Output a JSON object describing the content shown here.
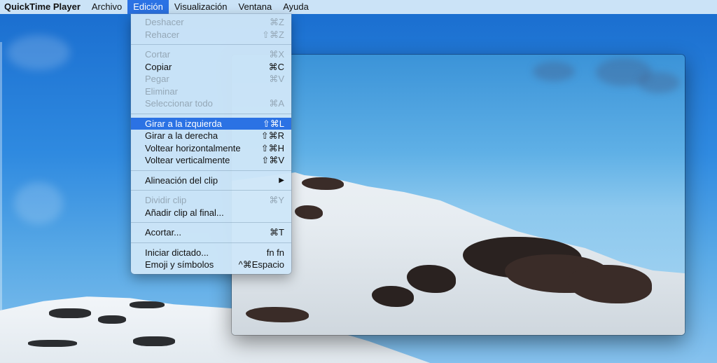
{
  "menubar": {
    "app": "QuickTime Player",
    "items": [
      "Archivo",
      "Edición",
      "Visualización",
      "Ventana",
      "Ayuda"
    ],
    "active_item": "Edición"
  },
  "menu": {
    "groups": [
      [
        {
          "label": "Deshacer",
          "shortcut": "⌘Z",
          "enabled": false
        },
        {
          "label": "Rehacer",
          "shortcut": "⇧⌘Z",
          "enabled": false
        }
      ],
      [
        {
          "label": "Cortar",
          "shortcut": "⌘X",
          "enabled": false
        },
        {
          "label": "Copiar",
          "shortcut": "⌘C",
          "enabled": true
        },
        {
          "label": "Pegar",
          "shortcut": "⌘V",
          "enabled": false
        },
        {
          "label": "Eliminar",
          "shortcut": "",
          "enabled": false
        },
        {
          "label": "Seleccionar todo",
          "shortcut": "⌘A",
          "enabled": false
        }
      ],
      [
        {
          "label": "Girar a la izquierda",
          "shortcut": "⇧⌘L",
          "enabled": true,
          "highlighted": true
        },
        {
          "label": "Girar a la derecha",
          "shortcut": "⇧⌘R",
          "enabled": true
        },
        {
          "label": "Voltear horizontalmente",
          "shortcut": "⇧⌘H",
          "enabled": true
        },
        {
          "label": "Voltear verticalmente",
          "shortcut": "⇧⌘V",
          "enabled": true
        }
      ],
      [
        {
          "label": "Alineación del clip",
          "shortcut": "",
          "enabled": true,
          "submenu": true
        }
      ],
      [
        {
          "label": "Dividir clip",
          "shortcut": "⌘Y",
          "enabled": false
        },
        {
          "label": "Añadir clip al final...",
          "shortcut": "",
          "enabled": true
        }
      ],
      [
        {
          "label": "Acortar...",
          "shortcut": "⌘T",
          "enabled": true
        }
      ],
      [
        {
          "label": "Iniciar dictado...",
          "shortcut": "fn fn",
          "enabled": true
        },
        {
          "label": "Emoji y símbolos",
          "shortcut": "^⌘Espacio",
          "enabled": true
        }
      ]
    ],
    "submenu_arrow_icon": "triangle-right-icon"
  },
  "colors": {
    "highlight": "#2b72e4",
    "disabled_text": "#94a7b6",
    "menu_background": "#cee6f8"
  }
}
